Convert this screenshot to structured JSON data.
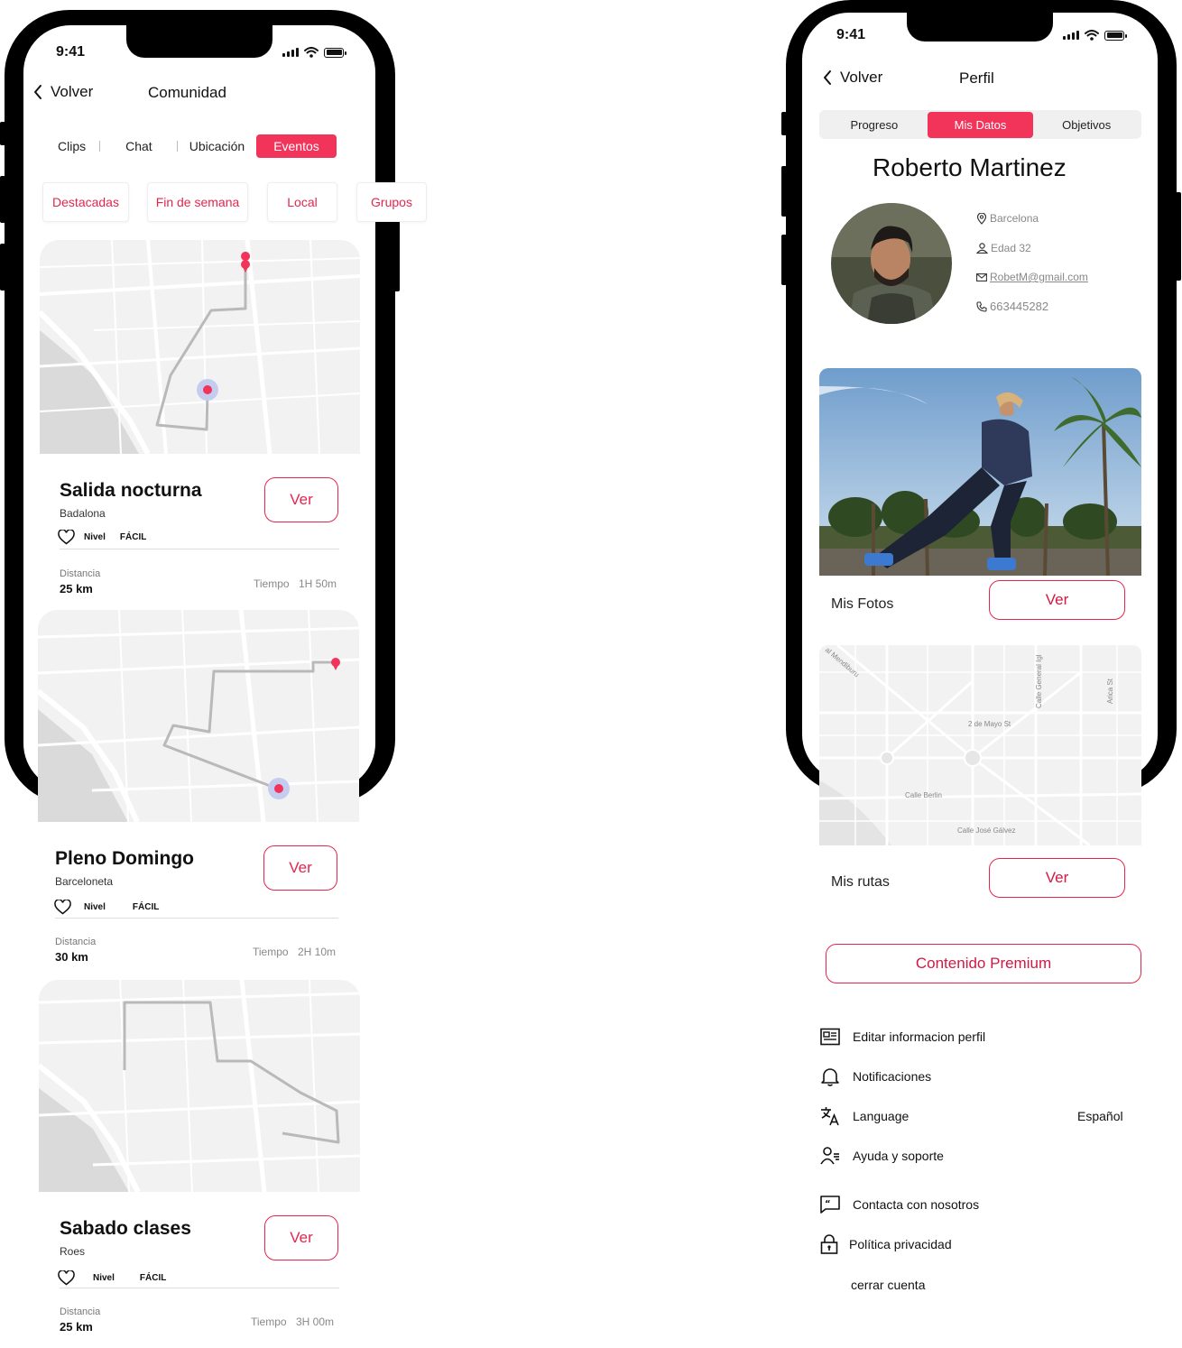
{
  "status": {
    "time": "9:41"
  },
  "community": {
    "back_label": "Volver",
    "title": "Comunidad",
    "tabs": [
      {
        "label": "Clips",
        "active": false
      },
      {
        "label": "Chat",
        "active": false
      },
      {
        "label": "Ubicación",
        "active": false
      },
      {
        "label": "Eventos",
        "active": true
      }
    ],
    "chips": [
      "Destacadas",
      "Fin de semana",
      "Local",
      "Grupos"
    ],
    "level_label": "Nivel",
    "distance_label": "Distancia",
    "time_label": "Tiempo",
    "view_label": "Ver",
    "events": [
      {
        "title": "Salida nocturna",
        "location": "Badalona",
        "level": "FÁCIL",
        "distance": "25 km",
        "time": "1H 50m"
      },
      {
        "title": "Pleno Domingo",
        "location": "Barceloneta",
        "level": "FÁCIL",
        "distance": "30 km",
        "time": "2H 10m"
      },
      {
        "title": "Sabado clases",
        "location": "Roes",
        "level": "FÁCIL",
        "distance": "25 km",
        "time": "3H 00m"
      }
    ]
  },
  "profile": {
    "back_label": "Volver",
    "title": "Perfil",
    "segments": [
      {
        "label": "Progreso",
        "active": false
      },
      {
        "label": "Mis Datos",
        "active": true
      },
      {
        "label": "Objetivos",
        "active": false
      }
    ],
    "name": "Roberto Martinez",
    "city": "Barcelona",
    "age": "Edad 32",
    "email": "RobetM@gmail.com",
    "phone": "663445282",
    "photos_label": "Mis Fotos",
    "routes_label": "Mis rutas",
    "view_label": "Ver",
    "premium_label": "Contenido Premium",
    "map_streets": [
      "al Mendiburu",
      "Calle General Igl",
      "Arica St",
      "2 de Mayo St",
      "Calle Berlin",
      "Calle José Gálvez"
    ],
    "menu": [
      {
        "label": "Editar informacion perfil",
        "icon": "profile-card-icon"
      },
      {
        "label": "Notificaciones",
        "icon": "bell-icon"
      },
      {
        "label": "Language",
        "icon": "translate-icon",
        "value": "Español"
      },
      {
        "label": "Ayuda y soporte",
        "icon": "support-icon"
      },
      {
        "label": "Contacta con nosotros",
        "icon": "chat-quote-icon"
      },
      {
        "label": "Política privacidad",
        "icon": "lock-icon"
      },
      {
        "label": "cerrar cuenta",
        "icon": ""
      }
    ]
  },
  "colors": {
    "accent": "#f2335a",
    "accent_text": "#e3264e",
    "route": "#b9b9b9",
    "map_bg": "#f2f2f2"
  }
}
